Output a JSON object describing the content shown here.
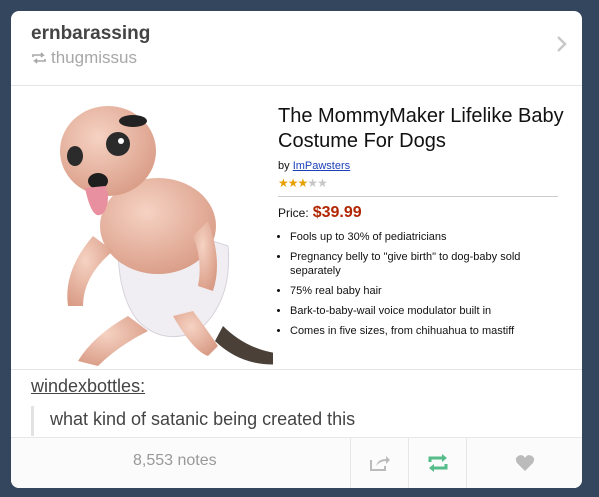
{
  "post": {
    "blog_name": "ernbarassing",
    "reblogged_from": "thugmissus"
  },
  "product": {
    "title": "The MommyMaker Lifelike Baby Costume For Dogs",
    "by_prefix": "by",
    "seller": "ImPawsters",
    "rating": 3,
    "rating_max": 5,
    "price_label": "Price:",
    "price": "$39.99",
    "features": [
      "Fools up to 30% of pediatricians",
      "Pregnancy belly to \"give birth\" to dog-baby sold separately",
      "75% real baby hair",
      "Bark-to-baby-wail voice modulator built in",
      "Comes in five sizes, from chihuahua to mastiff"
    ]
  },
  "comment": {
    "author": "windexbottles:",
    "text": "what kind of satanic being created this"
  },
  "footer": {
    "notes": "8,553 notes"
  },
  "colors": {
    "background": "#34465d",
    "reblog_green": "#56bc8a",
    "price_red": "#b12704"
  },
  "icons": [
    "reblog-small-icon",
    "chevron-right-icon",
    "share-icon",
    "reblog-icon",
    "heart-icon"
  ]
}
